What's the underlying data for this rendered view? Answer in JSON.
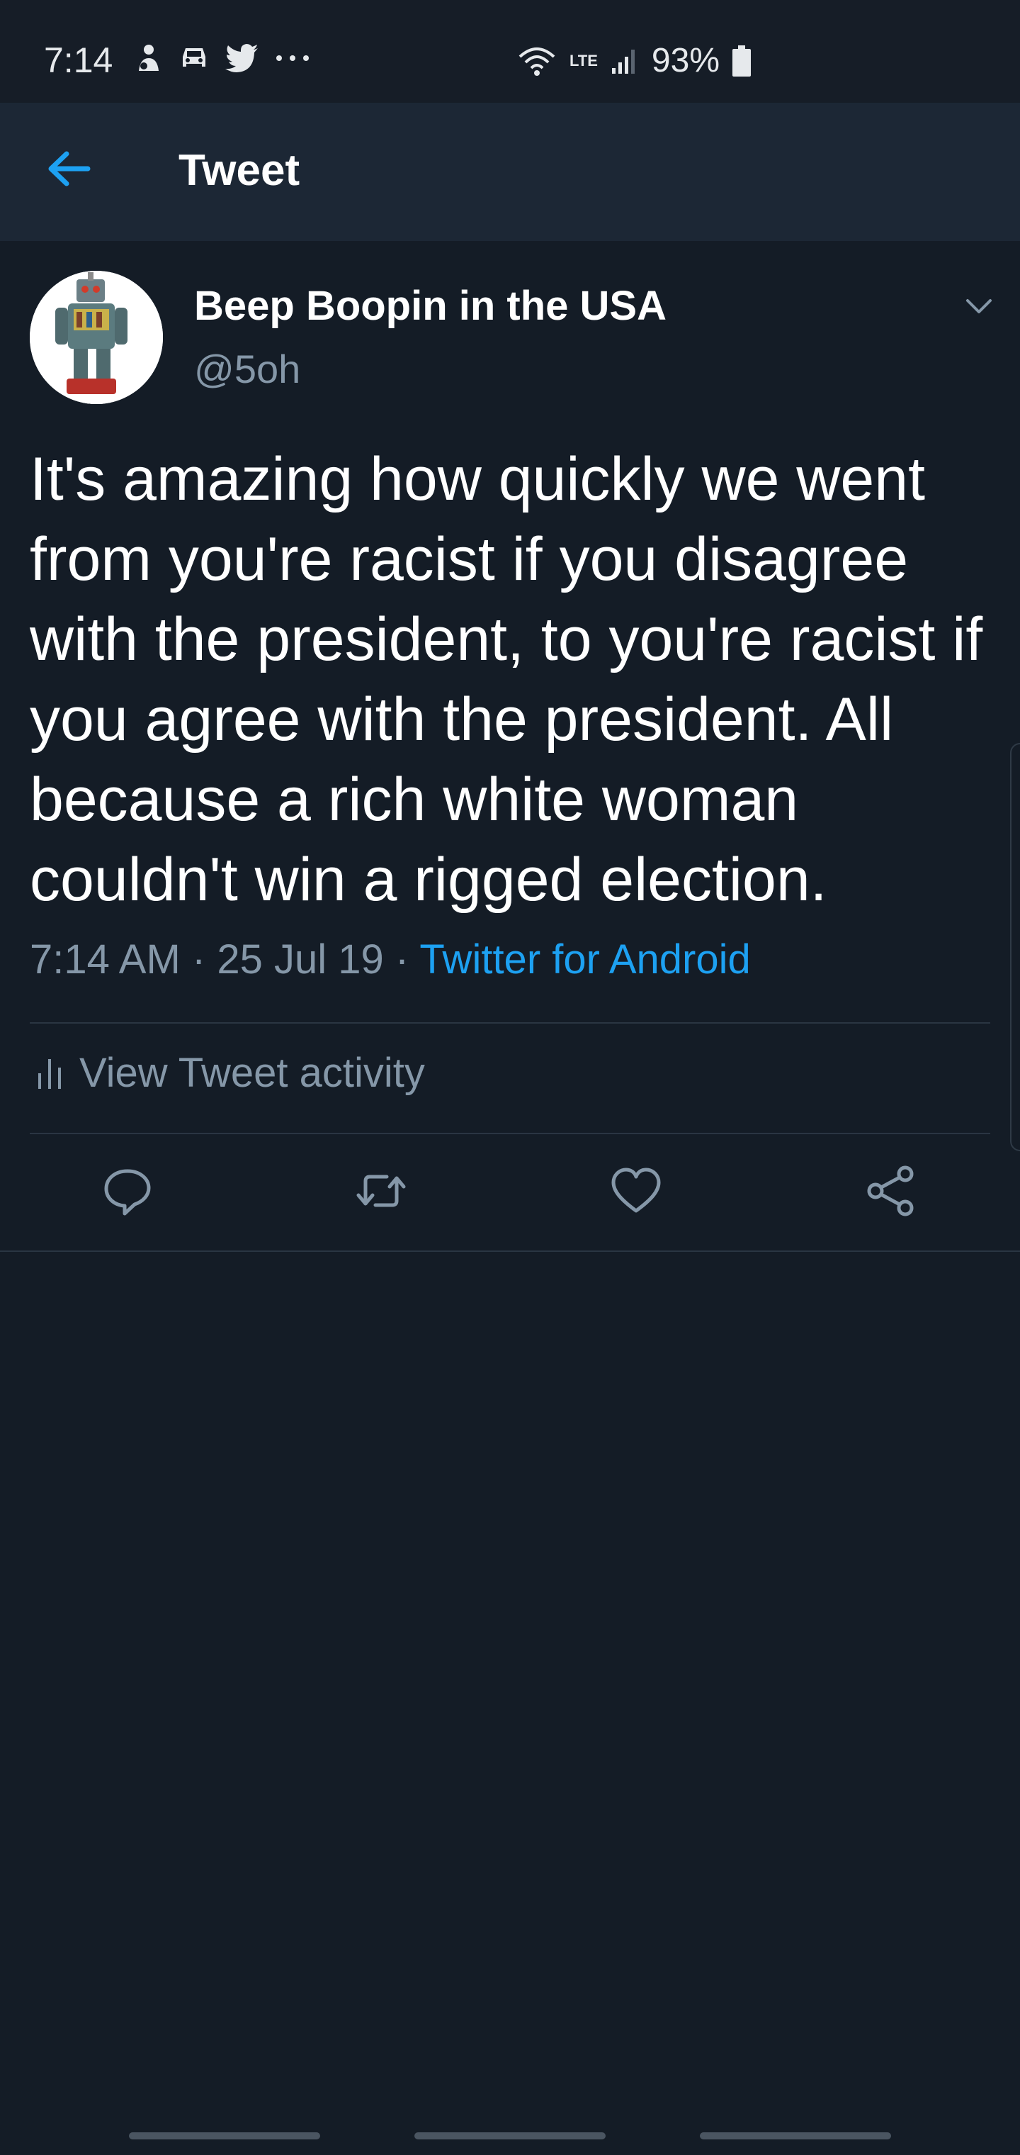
{
  "status_bar": {
    "time": "7:14",
    "network": "LTE",
    "battery": "93%",
    "icons": [
      "notification-person-icon",
      "car-icon",
      "twitter-bird-icon",
      "more-dots-icon",
      "wifi-icon",
      "lte-icon",
      "signal-icon",
      "battery-icon"
    ]
  },
  "app_bar": {
    "title": "Tweet",
    "back_icon": "back-arrow-icon"
  },
  "tweet": {
    "author_name": "Beep Boopin in the USA",
    "author_handle": "@5oh",
    "text": "It's amazing how quickly we went from you're racist if you disagree with the president, to you're racist if you agree with the president. All because a rich white woman couldn't win a rigged election.",
    "time": "7:14 AM",
    "date": "25 Jul 19",
    "separator": "·",
    "source": "Twitter for Android",
    "activity_label": "View Tweet activity"
  },
  "actions": [
    "reply-icon",
    "retweet-icon",
    "like-icon",
    "share-icon"
  ],
  "colors": {
    "background": "#141c26",
    "app_bar": "#1c2735",
    "accent": "#1da1f2",
    "secondary_text": "#8597a8"
  }
}
